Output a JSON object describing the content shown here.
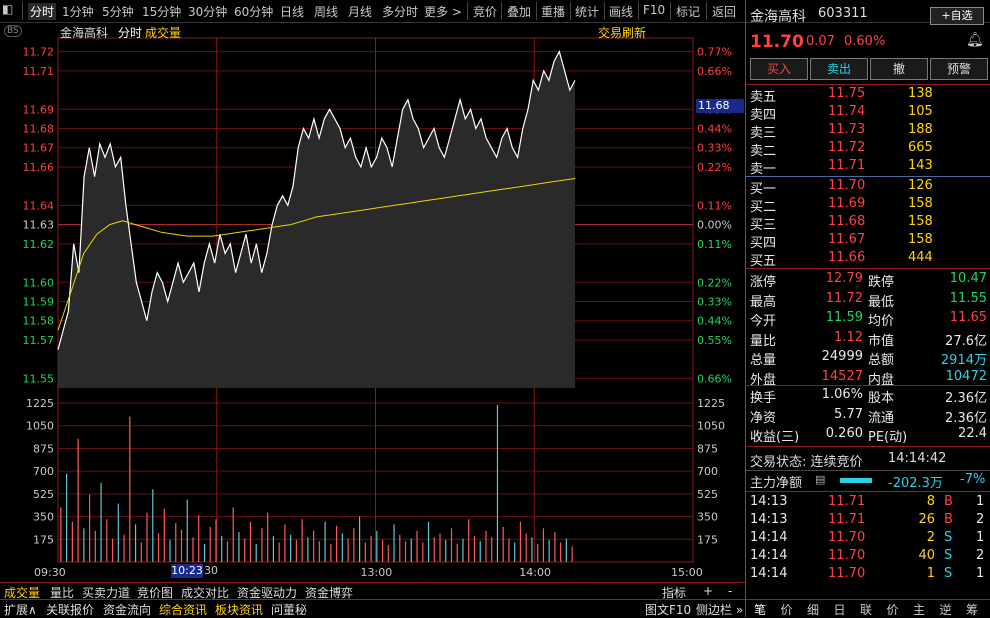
{
  "toolbar": {
    "periods": [
      "分时",
      "1分钟",
      "5分钟",
      "15分钟",
      "30分钟",
      "60分钟",
      "日线",
      "周线",
      "月线",
      "多分时",
      "更多 >"
    ],
    "tools": [
      "竞价",
      "叠加",
      "重播",
      "统计",
      "画线",
      "F10",
      "标记",
      "返回"
    ]
  },
  "chart": {
    "badge": "BS",
    "stock_name": "金海高科",
    "view_label": "分时",
    "volume_label": "成交量",
    "refresh_label": "交易刷新",
    "current_price_tag": "11.68",
    "time_cursor": "10:23",
    "partial_tick": "30"
  },
  "chart_data": {
    "type": "line",
    "title": "金海高科 分时",
    "x_ticks": [
      "09:30",
      "10:30",
      "13:00",
      "14:00",
      "15:00"
    ],
    "y_ticks_left": [
      "11.72",
      "11.71",
      "11.69",
      "11.68",
      "11.67",
      "11.66",
      "11.64",
      "11.63",
      "11.62",
      "11.60",
      "11.59",
      "11.58",
      "11.57",
      "11.55"
    ],
    "y_ticks_right": [
      "0.77%",
      "0.66%",
      "0.55%",
      "0.44%",
      "0.33%",
      "0.22%",
      "0.11%",
      "0.00%",
      "0.11%",
      "0.22%",
      "0.33%",
      "0.44%",
      "0.55%",
      "0.66%"
    ],
    "ylim": [
      11.545,
      11.725
    ],
    "prev_close": 11.63,
    "volume_ticks": [
      "1225",
      "1050",
      "875",
      "700",
      "525",
      "350",
      "175"
    ],
    "volume_ylim": [
      0,
      1310
    ],
    "price_series": [
      11.565,
      11.575,
      11.585,
      11.62,
      11.605,
      11.655,
      11.67,
      11.655,
      11.672,
      11.665,
      11.672,
      11.66,
      11.665,
      11.64,
      11.62,
      11.6,
      11.59,
      11.58,
      11.595,
      11.605,
      11.6,
      11.59,
      11.6,
      11.61,
      11.6,
      11.605,
      11.61,
      11.595,
      11.61,
      11.62,
      11.61,
      11.625,
      11.615,
      11.62,
      11.605,
      11.615,
      11.625,
      11.61,
      11.62,
      11.605,
      11.615,
      11.63,
      11.64,
      11.645,
      11.64,
      11.65,
      11.67,
      11.68,
      11.675,
      11.685,
      11.675,
      11.685,
      11.69,
      11.685,
      11.68,
      11.67,
      11.675,
      11.665,
      11.66,
      11.67,
      11.66,
      11.665,
      11.675,
      11.67,
      11.66,
      11.675,
      11.69,
      11.695,
      11.685,
      11.68,
      11.67,
      11.675,
      11.68,
      11.67,
      11.665,
      11.675,
      11.685,
      11.695,
      11.685,
      11.69,
      11.68,
      11.685,
      11.675,
      11.67,
      11.665,
      11.675,
      11.68,
      11.67,
      11.665,
      11.68,
      11.69,
      11.705,
      11.7,
      11.71,
      11.705,
      11.715,
      11.72,
      11.71,
      11.7,
      11.705
    ],
    "avg_series": [
      11.575,
      11.595,
      11.615,
      11.625,
      11.63,
      11.632,
      11.63,
      11.628,
      11.626,
      11.625,
      11.624,
      11.624,
      11.624,
      11.625,
      11.626,
      11.627,
      11.628,
      11.629,
      11.63,
      11.632,
      11.634,
      11.635,
      11.636,
      11.637,
      11.638,
      11.639,
      11.64,
      11.641,
      11.642,
      11.643,
      11.644,
      11.645,
      11.646,
      11.647,
      11.648,
      11.649,
      11.65,
      11.651,
      11.652,
      11.653,
      11.654
    ],
    "volume_series": [
      420,
      680,
      310,
      950,
      260,
      520,
      240,
      610,
      330,
      180,
      450,
      210,
      1120,
      290,
      150,
      380,
      560,
      220,
      410,
      170,
      300,
      250,
      480,
      190,
      360,
      140,
      270,
      330,
      200,
      160,
      420,
      230,
      180,
      310,
      140,
      260,
      380,
      200,
      150,
      290,
      210,
      170,
      330,
      190,
      240,
      160,
      310,
      140,
      280,
      220,
      180,
      260,
      350,
      150,
      200,
      240,
      170,
      130,
      290,
      210,
      160,
      180,
      240,
      150,
      310,
      190,
      220,
      170,
      260,
      140,
      180,
      330,
      200,
      160,
      240,
      190,
      1210,
      270,
      180,
      150,
      310,
      220,
      190,
      140,
      260,
      170,
      230,
      150,
      180,
      120
    ]
  },
  "quote": {
    "name": "金海高科",
    "code": "603311",
    "watch_button": "自选",
    "price": "11.70",
    "change": "0.07",
    "pct": "0.60%",
    "buy_button": "买入",
    "sell_button": "卖出",
    "cancel_button": "撤",
    "alert_button": "预警"
  },
  "asks": [
    {
      "label": "卖五",
      "price": "11.75",
      "vol": "138"
    },
    {
      "label": "卖四",
      "price": "11.74",
      "vol": "105"
    },
    {
      "label": "卖三",
      "price": "11.73",
      "vol": "188"
    },
    {
      "label": "卖二",
      "price": "11.72",
      "vol": "665"
    },
    {
      "label": "卖一",
      "price": "11.71",
      "vol": "143"
    }
  ],
  "bids": [
    {
      "label": "买一",
      "price": "11.70",
      "vol": "126"
    },
    {
      "label": "买二",
      "price": "11.69",
      "vol": "158"
    },
    {
      "label": "买三",
      "price": "11.68",
      "vol": "158"
    },
    {
      "label": "买四",
      "price": "11.67",
      "vol": "158"
    },
    {
      "label": "买五",
      "price": "11.66",
      "vol": "444"
    }
  ],
  "stats": [
    {
      "l1": "涨停",
      "v1": "12.79",
      "c1": "red",
      "l2": "跌停",
      "v2": "10.47",
      "c2": "green"
    },
    {
      "l1": "最高",
      "v1": "11.72",
      "c1": "red",
      "l2": "最低",
      "v2": "11.55",
      "c2": "green"
    },
    {
      "l1": "今开",
      "v1": "11.59",
      "c1": "green",
      "l2": "均价",
      "v2": "11.65",
      "c2": "red"
    },
    {
      "l1": "量比",
      "v1": "1.12",
      "c1": "red",
      "l2": "市值",
      "v2": "27.6亿",
      "c2": "white"
    },
    {
      "l1": "总量",
      "v1": "24999",
      "c1": "white",
      "l2": "总额",
      "v2": "2914万",
      "c2": "cyan"
    },
    {
      "l1": "外盘",
      "v1": "14527",
      "c1": "red",
      "l2": "内盘",
      "v2": "10472",
      "c2": "cyan"
    }
  ],
  "stats2": [
    {
      "l1": "换手",
      "v1": "1.06%",
      "l2": "股本",
      "v2": "2.36亿"
    },
    {
      "l1": "净资",
      "v1": "5.77",
      "l2": "流通",
      "v2": "2.36亿"
    },
    {
      "l1": "收益(三)",
      "v1": "0.260",
      "l2": "PE(动)",
      "v2": "22.4"
    }
  ],
  "trade_status_label": "交易状态: 连续竞价",
  "trade_status_time": "14:14:42",
  "main_flow_label": "主力净额",
  "main_flow_value": "-202.3万",
  "main_flow_pct": "-7%",
  "ticks": [
    {
      "time": "14:13",
      "price": "11.71",
      "vol": "8",
      "side": "B",
      "n": "1"
    },
    {
      "time": "14:13",
      "price": "11.71",
      "vol": "26",
      "side": "B",
      "n": "2"
    },
    {
      "time": "14:14",
      "price": "11.70",
      "vol": "2",
      "side": "S",
      "n": "1"
    },
    {
      "time": "14:14",
      "price": "11.70",
      "vol": "40",
      "side": "S",
      "n": "2"
    },
    {
      "time": "14:14",
      "price": "11.70",
      "vol": "1",
      "side": "S",
      "n": "1"
    }
  ],
  "bottom_tabs": [
    "成交量",
    "量比",
    "买卖力道",
    "竞价图",
    "成交对比",
    "资金驱动力",
    "资金博弈"
  ],
  "bottom_right": [
    "指标",
    "+",
    "-"
  ],
  "footer_tabs": [
    "扩展∧",
    "关联报价",
    "资金流向",
    "综合资讯",
    "板块资讯",
    "问董秘"
  ],
  "footer_right": [
    "图文F10",
    "侧边栏 »"
  ],
  "right_tabs": [
    "笔",
    "价",
    "细",
    "日",
    "联",
    "价",
    "主",
    "逆",
    "筹"
  ]
}
